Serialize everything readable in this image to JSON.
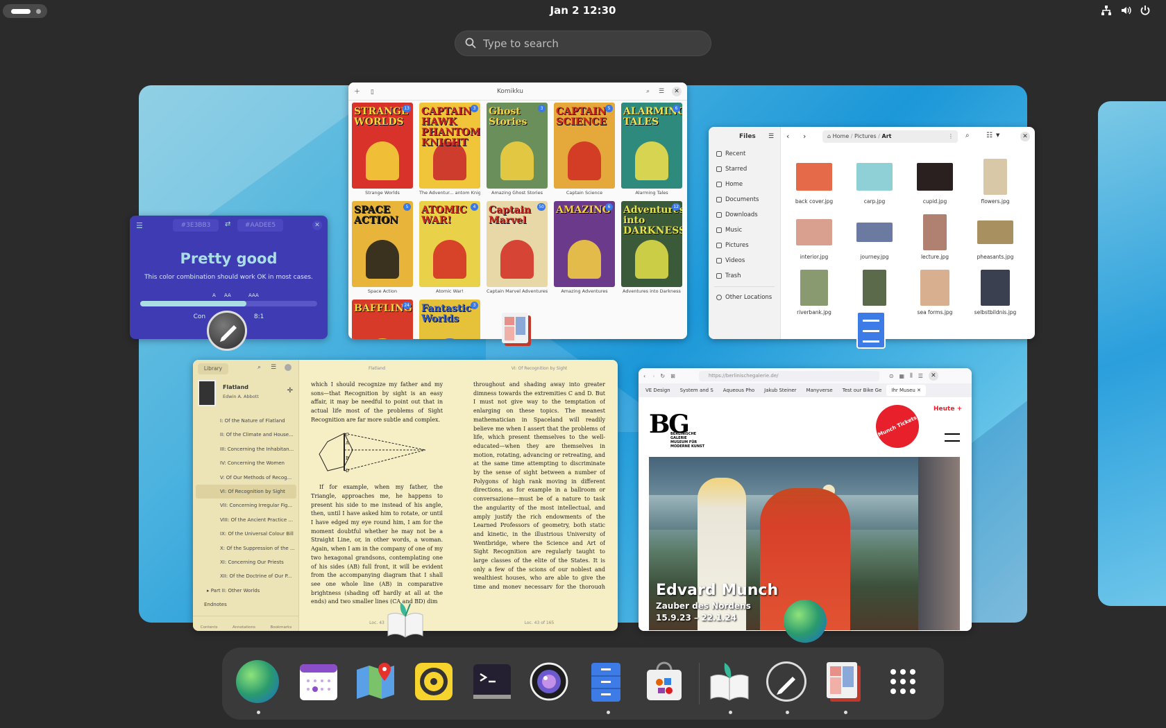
{
  "topbar": {
    "clock": "Jan 2  12:30",
    "tray_icons": [
      "network-icon",
      "volume-icon",
      "power-icon"
    ]
  },
  "search": {
    "placeholder": "Type to search"
  },
  "windows": {
    "contrast": {
      "fg_hex": "#3E3BB3",
      "bg_hex": "#AADEE5",
      "title": "Pretty good",
      "description": "This color combination should work OK in most cases.",
      "levels": [
        "A",
        "AA",
        "AAA"
      ],
      "ratio_fraction": 0.6,
      "ratio_label_left": "Con",
      "ratio_label_right": "8:1",
      "colors": {
        "background": "#3e3bb3",
        "foreground": "#aadee5"
      }
    },
    "komikku": {
      "title": "Komikku",
      "comics": [
        {
          "cover_title": "STRANGE WORLDS",
          "label": "Strange Worlds",
          "badge": "13",
          "bg": "#d8322a",
          "fg": "#f5d83a"
        },
        {
          "cover_title": "CAPTAIN HAWK PHANTOM KNIGHT",
          "label": "The Adventur... antom Knight",
          "badge": "3",
          "bg": "#f1c53a",
          "fg": "#c8232b"
        },
        {
          "cover_title": "Ghost Stories",
          "label": "Amazing Ghost Stories",
          "badge": "3",
          "bg": "#6b8f5a",
          "fg": "#f7d23e"
        },
        {
          "cover_title": "CAPTAIN SCIENCE",
          "label": "Captain Science",
          "badge": "5",
          "bg": "#e4a93a",
          "fg": "#d12a22"
        },
        {
          "cover_title": "ALARMING TALES",
          "label": "Alarming Tales",
          "badge": "6",
          "bg": "#2e8a7c",
          "fg": "#f4e04a"
        },
        {
          "cover_title": "SPACE ACTION",
          "label": "Space Action",
          "badge": "5",
          "bg": "#e8b43a",
          "fg": "#1b1b1b"
        },
        {
          "cover_title": "ATOMIC WAR!",
          "label": "Atomic War!",
          "badge": "4",
          "bg": "#e9d14a",
          "fg": "#d22a22"
        },
        {
          "cover_title": "Captain Marvel",
          "label": "Captain Marvel Adventures",
          "badge": "50",
          "bg": "#e8d8a8",
          "fg": "#d22a22"
        },
        {
          "cover_title": "AMAZING",
          "label": "Amazing Adventures",
          "badge": "6",
          "bg": "#6b3a8a",
          "fg": "#f7d23e"
        },
        {
          "cover_title": "Adventures into DARKNESS",
          "label": "Adventures into Darkness",
          "badge": "12",
          "bg": "#3a5a3a",
          "fg": "#e6e24a"
        },
        {
          "cover_title": "BAFFLING",
          "label": "",
          "badge": "24",
          "bg": "#d83a2a",
          "fg": "#f5d83a"
        },
        {
          "cover_title": "Fantastic Worlds",
          "label": "",
          "badge": "3",
          "bg": "#e6c23a",
          "fg": "#2a5bd8"
        }
      ]
    },
    "files": {
      "sidebar_title": "Files",
      "breadcrumb": [
        "Home",
        "Pictures",
        "Art"
      ],
      "sidebar": [
        "Recent",
        "Starred",
        "Home",
        "Documents",
        "Downloads",
        "Music",
        "Pictures",
        "Videos",
        "Trash"
      ],
      "other_locations": "Other Locations",
      "items": [
        {
          "name": "back cover.jpg",
          "color": "#e56a4a",
          "w": 52,
          "h": 40
        },
        {
          "name": "carp.jpg",
          "color": "#8fd0d6",
          "w": 52,
          "h": 40
        },
        {
          "name": "cupid.jpg",
          "color": "#2a2020",
          "w": 52,
          "h": 40
        },
        {
          "name": "flowers.jpg",
          "color": "#d9c8a8",
          "w": 34,
          "h": 52
        },
        {
          "name": "interior.jpg",
          "color": "#d9a090",
          "w": 52,
          "h": 38
        },
        {
          "name": "journey.jpg",
          "color": "#6a7aa0",
          "w": 52,
          "h": 28
        },
        {
          "name": "lecture.jpg",
          "color": "#b08070",
          "w": 34,
          "h": 52
        },
        {
          "name": "pheasants.jpg",
          "color": "#a89060",
          "w": 52,
          "h": 34
        },
        {
          "name": "riverbank.jpg",
          "color": "#8a9a70",
          "w": 40,
          "h": 52
        },
        {
          "name": "",
          "color": "#5a6a4a",
          "w": 34,
          "h": 52
        },
        {
          "name": "sea forms.jpg",
          "color": "#d8b090",
          "w": 42,
          "h": 52
        },
        {
          "name": "selbstbildnis.jpg",
          "color": "#3a4050",
          "w": 42,
          "h": 52
        }
      ]
    },
    "reader": {
      "library_label": "Library",
      "book_title": "Flatland",
      "book_author": "Edwin A. Abbott",
      "toc": [
        {
          "label": "I: Of the Nature of Flatland",
          "level": 2
        },
        {
          "label": "II: Of the Climate and House...",
          "level": 2
        },
        {
          "label": "III: Concerning the Inhabitan...",
          "level": 2
        },
        {
          "label": "IV: Concerning the Women",
          "level": 2
        },
        {
          "label": "V: Of Our Methods of Recog...",
          "level": 2
        },
        {
          "label": "VI: Of Recognition by Sight",
          "level": 2,
          "active": true
        },
        {
          "label": "VII: Concerning Irregular Fig...",
          "level": 2
        },
        {
          "label": "VIII: Of the Ancient Practice ...",
          "level": 2
        },
        {
          "label": "IX: Of the Universal Colour Bill",
          "level": 2
        },
        {
          "label": "X: Of the Suppression of the ...",
          "level": 2
        },
        {
          "label": "XI: Concerning Our Priests",
          "level": 2
        },
        {
          "label": "XII: Of the Doctrine of Our P...",
          "level": 2
        },
        {
          "label": "Part II: Other Worlds",
          "level": 1
        },
        {
          "label": "Endnotes",
          "level": 0
        }
      ],
      "tabs": [
        "Contents",
        "Annotations",
        "Bookmarks"
      ],
      "left_header": "Flatland",
      "right_header": "VI: Of Recognition by Sight",
      "left_text_top": "which I should recognize my father and my sons—that Recognition by sight is an easy affair, it may be needful to point out that in actual life most of the problems of Sight Recognition are far more subtle and complex.",
      "left_text_bottom": "If for example, when my father, the Triangle, approaches me, he happens to present his side to me instead of his angle, then, until I have asked him to rotate, or until I have edged my eye round him, I am for the moment doubtful whether he may not be a Straight Line, or, in other words, a woman. Again, when I am in the company of one of my two hexagonal grandsons, contemplating one of his sides (AB) full front, it will be evident from the accompanying diagram that I shall see one whole line (AB) in comparative brightness (shading off hardly at all at the ends) and two smaller lines (CA and BD) dim",
      "right_text": "throughout and shading away into greater dimness towards the extremities C and D. But I must not give way to the temptation of enlarging on these topics. The meanest mathematician in Spaceland will readily believe me when I assert that the problems of life, which present themselves to the well-educated—when they are themselves in motion, rotating, advancing or retreating, and at the same time attempting to discriminate by the sense of sight between a number of Polygons of high rank moving in different directions, as for example in a ballroom or conversazione—must be of a nature to task the angularity of the most intellectual, and amply justify the rich endowments of the Learned Professors of geometry, both static and kinetic, in the illustrious University of Wentbridge, where the Science and Art of Sight Recognition are regularly taught to large classes of the elite of the States. It is only a few of the scions of our noblest and wealthiest houses, who are able to give the time and money necessary for the thorough prosecution of this noble and valuable Art. Even to me, a mathematician of no",
      "left_footer": "Loc. 43",
      "right_footer": "Loc. 43 of 165",
      "diagram_labels": [
        "C",
        "A",
        "B",
        "D"
      ]
    },
    "browser": {
      "url": "https://berlinischegalerie.de/",
      "tabs": [
        "VE Design",
        "System and S",
        "Aqueous Pho",
        "Jakub Steiner",
        "Manyverse",
        "Test our Bike Ge",
        "Ihr Museu"
      ],
      "logo": "BG",
      "logo_sub": [
        "BERLINISCHE",
        "GALERIE",
        "MUSEUM FÜR",
        "MODERNE KUNST"
      ],
      "badge": "Munch Tickets",
      "heute": "Heute",
      "exhibition_title": "Edvard Munch",
      "exhibition_sub": "Zauber des Nordens",
      "exhibition_dates": "15.9.23 – 22.1.24"
    }
  },
  "dock": {
    "apps": [
      {
        "name": "web-browser",
        "running": true
      },
      {
        "name": "calendar",
        "running": false
      },
      {
        "name": "maps",
        "running": false
      },
      {
        "name": "music",
        "running": false
      },
      {
        "name": "terminal",
        "running": false
      },
      {
        "name": "camera",
        "running": false
      },
      {
        "name": "files",
        "running": true
      },
      {
        "name": "software",
        "running": false
      },
      {
        "name": "reader",
        "running": true
      },
      {
        "name": "contrast",
        "running": true
      },
      {
        "name": "komikku",
        "running": true
      },
      {
        "name": "app-grid",
        "running": false
      }
    ]
  }
}
